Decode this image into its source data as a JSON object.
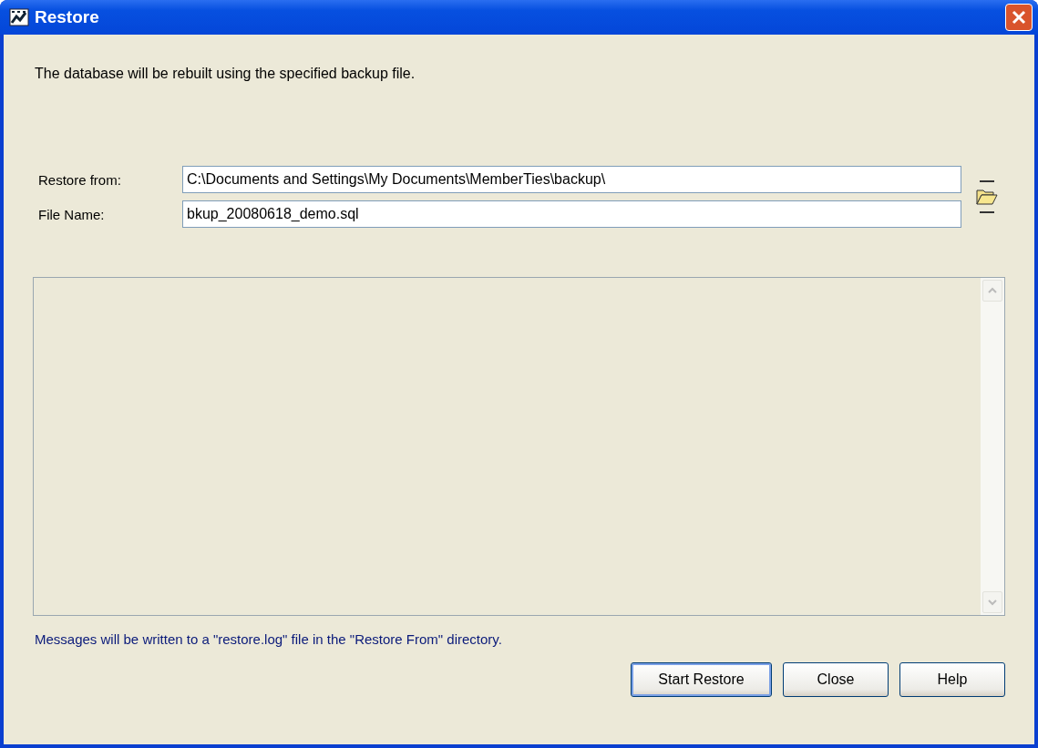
{
  "window": {
    "title": "Restore"
  },
  "intro": "The database will be rebuilt using the specified backup file.",
  "fields": [
    {
      "label": "Restore from:",
      "value": "C:\\Documents and Settings\\My Documents\\MemberTies\\backup\\"
    },
    {
      "label": "File Name:",
      "value": "bkup_20080618_demo.sql"
    }
  ],
  "message": "Messages will be written to a \"restore.log\" file in the \"Restore From\" directory.",
  "buttons": [
    {
      "label": "Start Restore",
      "default": true
    },
    {
      "label": "Close",
      "default": false
    },
    {
      "label": "Help",
      "default": false
    }
  ]
}
